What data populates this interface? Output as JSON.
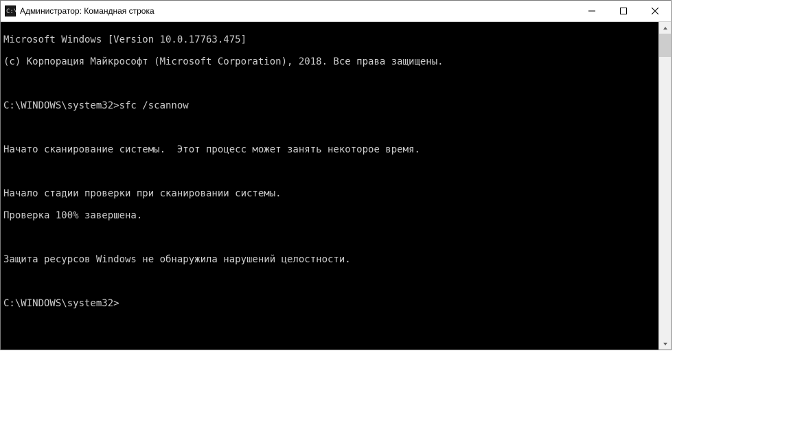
{
  "window": {
    "title": "Администратор: Командная строка"
  },
  "terminal": {
    "line_version": "Microsoft Windows [Version 10.0.17763.475]",
    "line_copyright": "(c) Корпорация Майкрософт (Microsoft Corporation), 2018. Все права защищены.",
    "prompt1_path": "C:\\WINDOWS\\system32>",
    "prompt1_cmd": "sfc /scannow",
    "scan_started": "Начато сканирование системы.  Этот процесс может занять некоторое время.",
    "stage_start": "Начало стадии проверки при сканировании системы.",
    "progress": "Проверка 100% завершена.",
    "result": "Защита ресурсов Windows не обнаружила нарушений целостности.",
    "prompt2_path": "C:\\WINDOWS\\system32>"
  }
}
